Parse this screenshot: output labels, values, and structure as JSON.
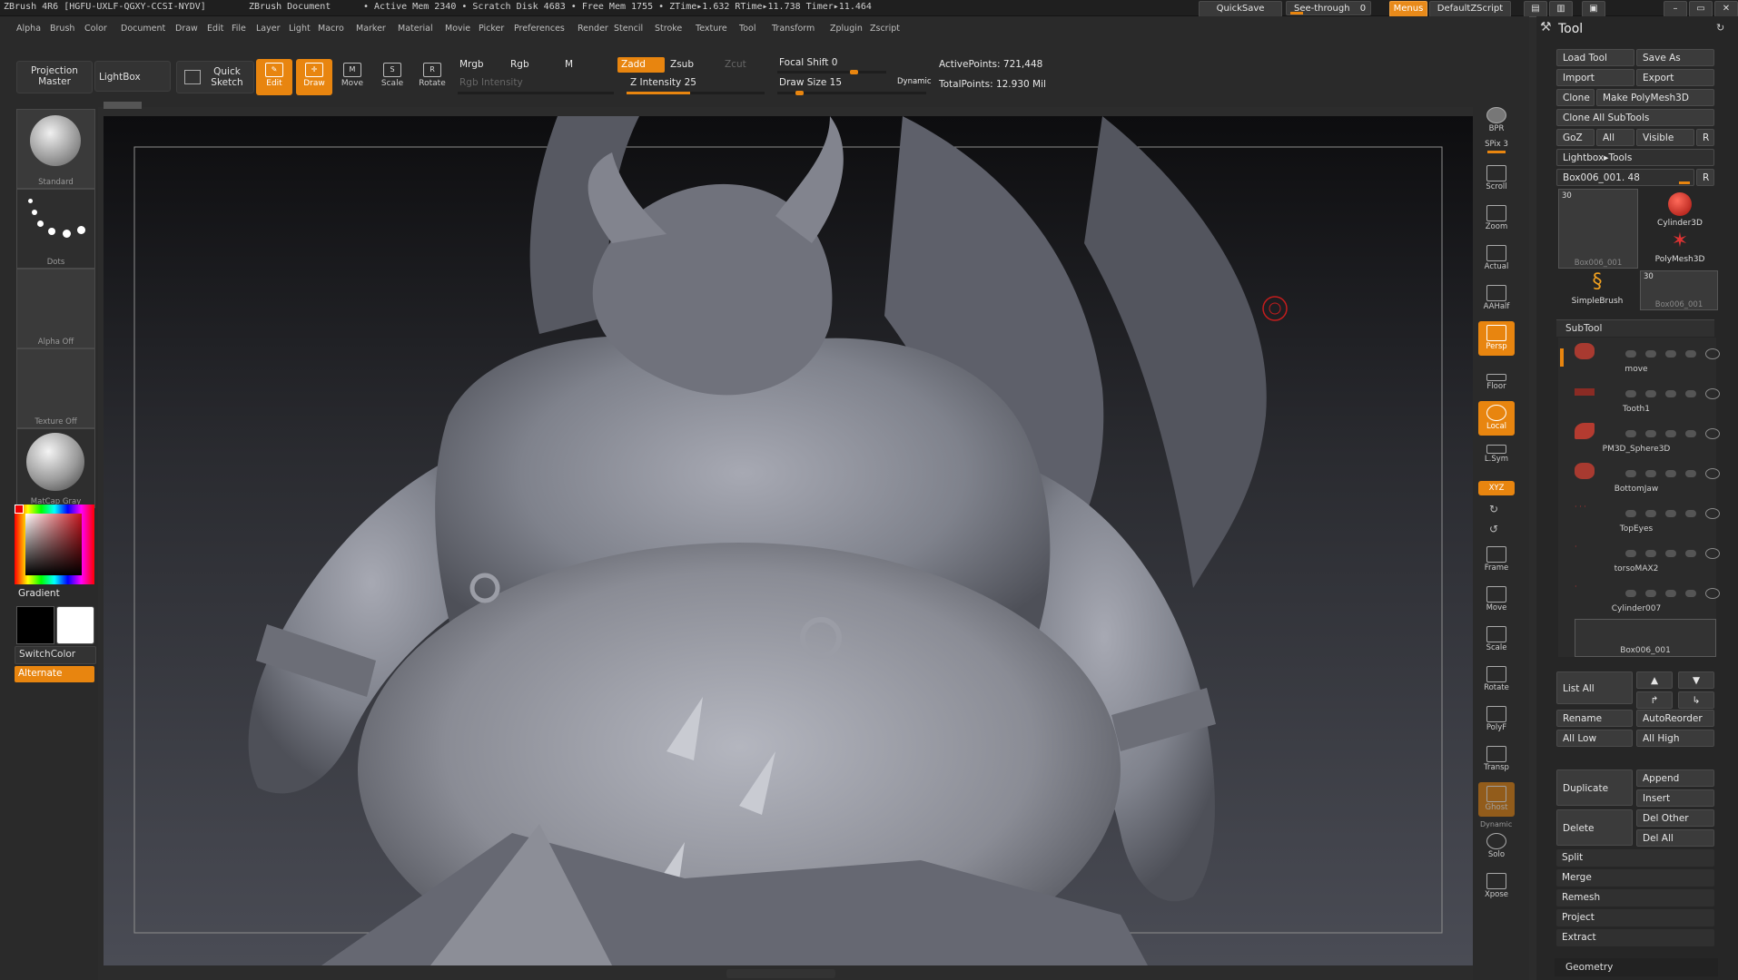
{
  "title_bar": {
    "app": "ZBrush 4R6 [HGFU-UXLF-QGXY-CCSI-NYDV]",
    "document": "ZBrush Document",
    "stats": "• Active Mem 2340  • Scratch Disk 4683  • Free Mem 1755  • ZTime▸1.632 RTime▸11.738 Timer▸11.464",
    "quicksave": "QuickSave",
    "see_through": "See-through",
    "see_through_value": "0",
    "menus": "Menus",
    "script": "DefaultZScript"
  },
  "menu_bar": [
    "Alpha",
    "Brush",
    "Color",
    "Document",
    "Draw",
    "Edit",
    "File",
    "Layer",
    "Light",
    "Macro",
    "Marker",
    "Material",
    "Movie",
    "Picker",
    "Preferences",
    "Render",
    "Stencil",
    "Stroke",
    "Texture",
    "Tool",
    "Transform",
    "Zplugin",
    "Zscript"
  ],
  "toolbar": {
    "projection_master": "Projection Master",
    "lightbox": "LightBox",
    "quick_sketch": "Quick Sketch",
    "edit": "Edit",
    "draw": "Draw",
    "move": "Move",
    "scale": "Scale",
    "rotate": "Rotate",
    "mrgb": "Mrgb",
    "rgb": "Rgb",
    "m": "M",
    "zadd": "Zadd",
    "zsub": "Zsub",
    "zcut": "Zcut",
    "rgb_intensity": "Rgb Intensity",
    "z_intensity": "Z Intensity 25",
    "focal_shift": "Focal Shift 0",
    "draw_size": "Draw Size 15",
    "dynamic": "Dynamic",
    "active_points": "ActivePoints: 721,448",
    "total_points": "TotalPoints: 12.930 Mil"
  },
  "left_shelf": {
    "brush": "Standard",
    "stroke": "Dots",
    "alpha": "Alpha Off",
    "texture": "Texture Off",
    "material": "MatCap Gray",
    "gradient": "Gradient",
    "switch_color": "SwitchColor",
    "alternate": "Alternate"
  },
  "right_shelf": [
    {
      "label": "BPR",
      "on": false
    },
    {
      "label": "SPix 3",
      "on": false
    },
    {
      "label": "Scroll",
      "on": false
    },
    {
      "label": "Zoom",
      "on": false
    },
    {
      "label": "Actual",
      "on": false
    },
    {
      "label": "AAHalf",
      "on": false
    },
    {
      "label": "Persp",
      "on": true
    },
    {
      "label": "Floor",
      "on": false
    },
    {
      "label": "Local",
      "on": true
    },
    {
      "label": "L.Sym",
      "on": false
    },
    {
      "label": "XYZ",
      "on": true
    },
    {
      "label": "Frame",
      "on": false
    },
    {
      "label": "Move",
      "on": false
    },
    {
      "label": "Scale",
      "on": false
    },
    {
      "label": "Rotate",
      "on": false
    },
    {
      "label": "PolyF",
      "on": false
    },
    {
      "label": "Transp",
      "on": false
    },
    {
      "label": "Ghost",
      "on": true
    },
    {
      "label": "Solo",
      "on": false
    },
    {
      "label": "Xpose",
      "on": false
    }
  ],
  "right_shelf_dynamic": "Dynamic",
  "tool_panel": {
    "title": "Tool",
    "load_tool": "Load Tool",
    "save_as": "Save As",
    "import": "Import",
    "export": "Export",
    "clone": "Clone",
    "make_polymesh": "Make PolyMesh3D",
    "clone_all_subtools": "Clone All SubTools",
    "goz": "GoZ",
    "all": "All",
    "visible": "Visible",
    "r": "R",
    "lightbox_tools": "Lightbox▸Tools",
    "current_tool": "Box006_001. 48",
    "thumb_count_a": "30",
    "thumb_count_b": "30",
    "thumb_name_a": "Box006_001",
    "thumb_cylinder": "Cylinder3D",
    "thumb_polymesh": "PolyMesh3D",
    "thumb_simplebrush": "SimpleBrush",
    "thumb_name_b": "Box006_001",
    "subtool_header": "SubTool",
    "subtools": [
      "move",
      "Tooth1",
      "PM3D_Sphere3D",
      "BottomJaw",
      "TopEyes",
      "torsoMAX2",
      "Cylinder007",
      "Box006_001"
    ],
    "list_all": "List All",
    "rename": "Rename",
    "autoreorder": "AutoReorder",
    "all_low": "All Low",
    "all_high": "All High",
    "duplicate": "Duplicate",
    "append": "Append",
    "insert": "Insert",
    "delete": "Delete",
    "del_other": "Del Other",
    "del_all": "Del All",
    "split": "Split",
    "merge": "Merge",
    "remesh": "Remesh",
    "project": "Project",
    "extract": "Extract",
    "geometry": "Geometry"
  },
  "colors": {
    "accent": "#e8850f",
    "background": "#2a2a2a"
  }
}
